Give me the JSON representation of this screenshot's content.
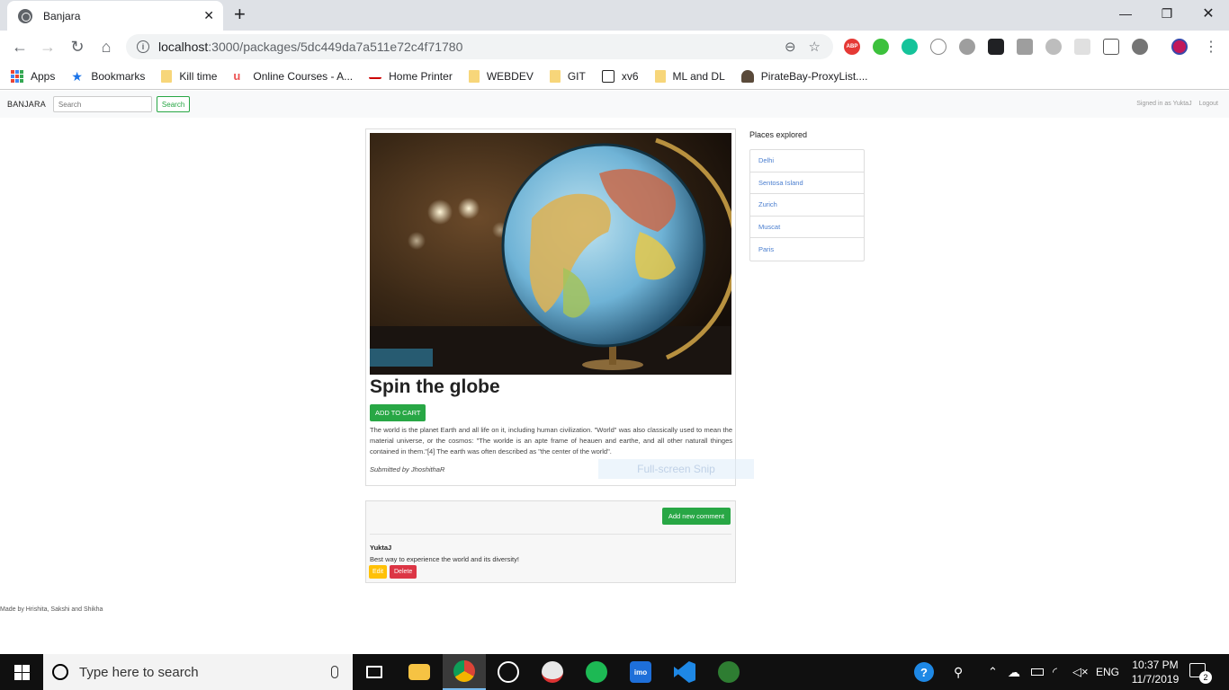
{
  "browser": {
    "tab_title": "Banjara",
    "url_host": "localhost",
    "url_rest": ":3000/packages/5dc449da7a511e72c4f71780",
    "bookmarks": [
      {
        "label": "Apps",
        "icon": "apps-grid-icon"
      },
      {
        "label": "Bookmarks",
        "icon": "star-icon"
      },
      {
        "label": "Kill time",
        "icon": "folder-icon"
      },
      {
        "label": "Online Courses - A...",
        "icon": "udemy-icon"
      },
      {
        "label": "Home Printer",
        "icon": "canon-icon"
      },
      {
        "label": "WEBDEV",
        "icon": "folder-icon"
      },
      {
        "label": "GIT",
        "icon": "folder-icon"
      },
      {
        "label": "xv6",
        "icon": "pdos-icon"
      },
      {
        "label": "ML and DL",
        "icon": "folder-icon"
      },
      {
        "label": "PirateBay-ProxyList....",
        "icon": "pirate-ship-icon"
      }
    ],
    "ext_labels": {
      "abp": "ABP"
    }
  },
  "site": {
    "brand": "BANJARA",
    "search_placeholder": "Search",
    "search_button": "Search",
    "signed_in": "Signed in as YuktaJ",
    "logout": "Logout"
  },
  "package": {
    "title": "Spin the globe",
    "add_to_cart": "ADD TO CART",
    "description": "The world is the planet Earth and all life on it, including human civilization. \"World\" was also classically used to mean the material universe, or the cosmos: \"The worlde is an apte frame of heauen and earthe, and all other naturall thinges contained in them.\"[4] The earth was often described as \"the center of the world\".",
    "submitted_by": "Submitted by JhoshithaR"
  },
  "places": {
    "title": "Places explored",
    "items": [
      "Delhi",
      "Sentosa Island",
      "Zurich",
      "Muscat",
      "Paris"
    ]
  },
  "comments": {
    "add_button": "Add new comment",
    "items": [
      {
        "author": "YuktaJ",
        "text": "Best way to experience the world and its diversity!",
        "edit": "Edit",
        "delete": "Delete"
      }
    ]
  },
  "overlay": {
    "snip": "Full-screen Snip"
  },
  "footer": "Made by Hrishita, Sakshi and Shikha",
  "taskbar": {
    "search_placeholder": "Type here to search",
    "lang": "ENG",
    "time": "10:37 PM",
    "date": "11/7/2019",
    "notifications": "2",
    "apps": [
      "task-view-icon",
      "file-explorer-icon",
      "chrome-icon",
      "alarms-icon",
      "paint-icon",
      "spotify-icon",
      "imo-icon",
      "vscode-icon",
      "mongodb-icon"
    ],
    "imo_label": "imo"
  },
  "colors": {
    "accent_green": "#28a745",
    "link_blue": "#4a7ecf",
    "edit_yellow": "#ffc107",
    "delete_red": "#dc3545"
  }
}
